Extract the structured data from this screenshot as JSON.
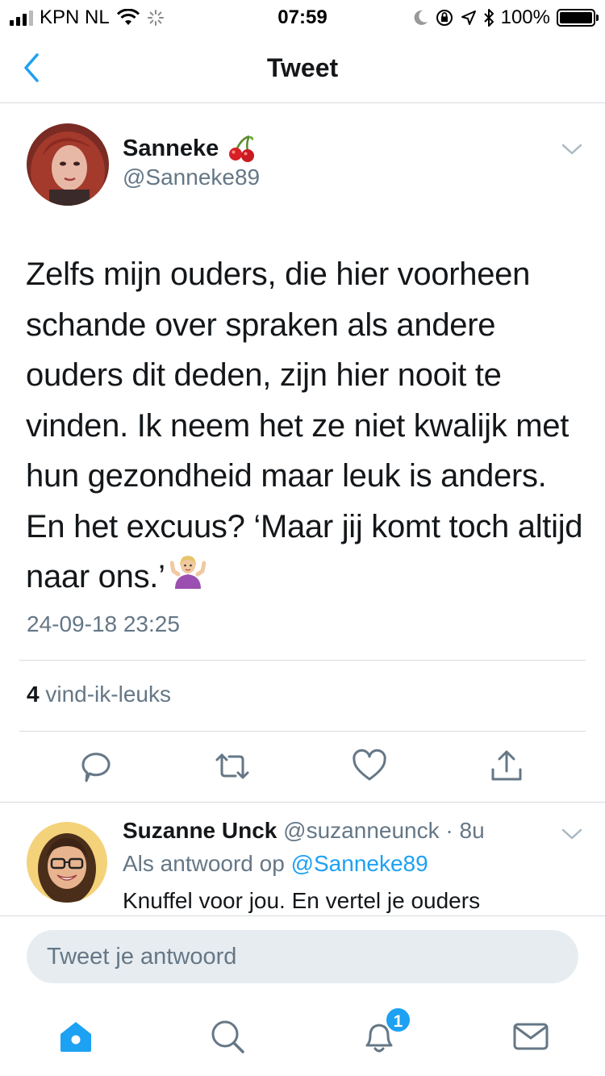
{
  "status_bar": {
    "carrier": "KPN NL",
    "time": "07:59",
    "battery": "100%"
  },
  "nav": {
    "title": "Tweet"
  },
  "tweet": {
    "author_name": "Sanneke",
    "author_emoji": "cherries-icon",
    "author_handle": "@Sanneke89",
    "text": "Zelfs mijn ouders, die hier voorheen schande over spraken als andere ouders dit deden, zijn hier nooit te vinden. Ik neem het ze niet kwalijk met hun gezondheid maar leuk is anders. En het excuus? ‘Maar jij komt toch altijd naar ons.’",
    "text_emoji": "shrug-icon",
    "timestamp": "24-09-18 23:25",
    "likes_count": "4",
    "likes_label": "vind-ik-leuks"
  },
  "reply": {
    "author_name": "Suzanne Unck",
    "author_handle": "@suzanneunck",
    "time": "· 8u",
    "reply_to_prefix": "Als antwoord op",
    "reply_to_mention": "@Sanneke89",
    "text": "Knuffel voor jou. En vertel je ouders"
  },
  "composer": {
    "placeholder": "Tweet je antwoord"
  },
  "tabbar": {
    "notification_badge": "1"
  },
  "colors": {
    "accent": "#1da1f2",
    "secondary_text": "#657786",
    "divider": "#d7dbde"
  }
}
